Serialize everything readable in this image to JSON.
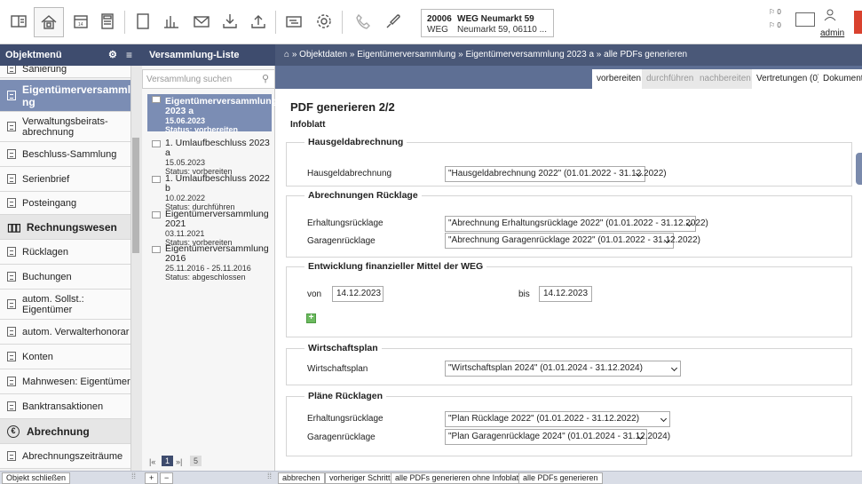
{
  "toolbar": {
    "object_number": "20006",
    "object_type": "WEG",
    "object_name": "WEG Neumarkt 59",
    "object_address": "Neumarkt 59, 06110 ...",
    "notif_count_1": "0",
    "notif_count_2": "0",
    "user": "admin"
  },
  "headers": {
    "left": "Objektmenü",
    "middle": "Versammlung-Liste",
    "breadcrumb": "» Objektdaten » Eigentümerversammlung » Eigentümerversammlung 2023 a » alle PDFs generieren"
  },
  "sidebar": {
    "items": [
      {
        "label": "Sanierung"
      },
      {
        "label": "Eigentümerversammlu ng"
      },
      {
        "label": "Verwaltungsbeirats-abrechnung"
      },
      {
        "label": "Beschluss-Sammlung"
      },
      {
        "label": "Serienbrief"
      },
      {
        "label": "Posteingang"
      },
      {
        "label": "Rechnungswesen"
      },
      {
        "label": "Rücklagen"
      },
      {
        "label": "Buchungen"
      },
      {
        "label": "autom. Sollst.: Eigentümer"
      },
      {
        "label": "autom. Verwalterhonorar"
      },
      {
        "label": "Konten"
      },
      {
        "label": "Mahnwesen: Eigentümer"
      },
      {
        "label": "Banktransaktionen"
      },
      {
        "label": "Abrechnung"
      },
      {
        "label": "Abrechnungszeiträume"
      }
    ]
  },
  "list": {
    "search_placeholder": "Versammlung suchen",
    "items": [
      {
        "title": "Eigentümerversammlung 2023 a",
        "date": "15.06.2023",
        "status": "Status: vorbereiten"
      },
      {
        "title": "1. Umlaufbeschluss 2023 a",
        "date": "15.05.2023",
        "status": "Status: vorbereiten"
      },
      {
        "title": "1. Umlaufbeschluss 2022 b",
        "date": "10.02.2022",
        "status": "Status: durchführen"
      },
      {
        "title": "Eigentümerversammlung 2021",
        "date": "03.11.2021",
        "status": "Status: vorbereiten"
      },
      {
        "title": "Eigentümerversammlung 2016",
        "date": "25.11.2016 - 25.11.2016",
        "status": "Status: abgeschlossen"
      }
    ],
    "pager": {
      "current": "1",
      "total": "5"
    }
  },
  "tabs": [
    "vorbereiten",
    "durchführen",
    "nachbereiten",
    "Vertretungen (0)",
    "Dokumente"
  ],
  "main": {
    "title": "PDF generieren 2/2",
    "subtitle": "Infoblatt",
    "hausgeld": {
      "legend": "Hausgeldabrechnung",
      "label": "Hausgeldabrechnung",
      "value": "\"Hausgeldabrechnung 2022\" (01.01.2022 - 31.12.2022)"
    },
    "ruecklage": {
      "legend": "Abrechnungen Rücklage",
      "label1": "Erhaltungsrücklage",
      "value1": "\"Abrechnung Erhaltungsrücklage 2022\" (01.01.2022 - 31.12.2022)",
      "label2": "Garagenrücklage",
      "value2": "\"Abrechnung Garagenrücklage 2022\" (01.01.2022 - 31.12.2022)"
    },
    "entwicklung": {
      "legend": "Entwicklung finanzieller Mittel der WEG",
      "from_label": "von",
      "from_value": "14.12.2023",
      "to_label": "bis",
      "to_value": "14.12.2023"
    },
    "wirtschaftsplan": {
      "legend": "Wirtschaftsplan",
      "label": "Wirtschaftsplan",
      "value": "\"Wirtschaftsplan 2024\" (01.01.2024 - 31.12.2024)"
    },
    "plaene": {
      "legend": "Pläne Rücklagen",
      "label1": "Erhaltungsrücklage",
      "value1": "\"Plan Rücklage 2022\" (01.01.2022 - 31.12.2022)",
      "label2": "Garagenrücklage",
      "value2": "\"Plan Garagenrücklage 2024\" (01.01.2024 - 31.12.2024)"
    }
  },
  "footer": {
    "close": "Objekt schließen",
    "plus": "+",
    "minus": "−",
    "cancel": "abbrechen",
    "prev": "vorheriger Schritt",
    "gen_without": "alle PDFs generieren ohne Infoblatt",
    "gen_all": "alle PDFs generieren"
  }
}
